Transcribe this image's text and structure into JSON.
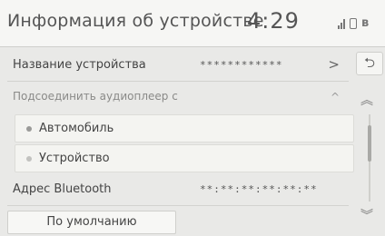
{
  "header": {
    "title": "Информация об устройстве",
    "clock": "4:29",
    "status_icons": [
      "signal-icon",
      "phone-icon",
      "bluetooth-icon"
    ]
  },
  "rows": {
    "device_name": {
      "label": "Название устройства",
      "value": "************",
      "arrow": ">"
    },
    "connect_audio": {
      "label": "Подсоединить аудиоплеер с",
      "arrow": "^"
    },
    "option_car": {
      "label": "Автомобиль"
    },
    "option_device": {
      "label": "Устройство"
    },
    "bt_address": {
      "label": "Адрес Bluetooth",
      "value": "**:**:**:**:**:**"
    }
  },
  "buttons": {
    "default_label": "По умолчанию",
    "back_glyph": "⮌",
    "scroll_up_glyph": "︽",
    "scroll_down_glyph": "︾"
  },
  "colors": {
    "background": "#e9e9e7",
    "header": "#f6f6f4",
    "option_bg": "#f4f4f1"
  }
}
